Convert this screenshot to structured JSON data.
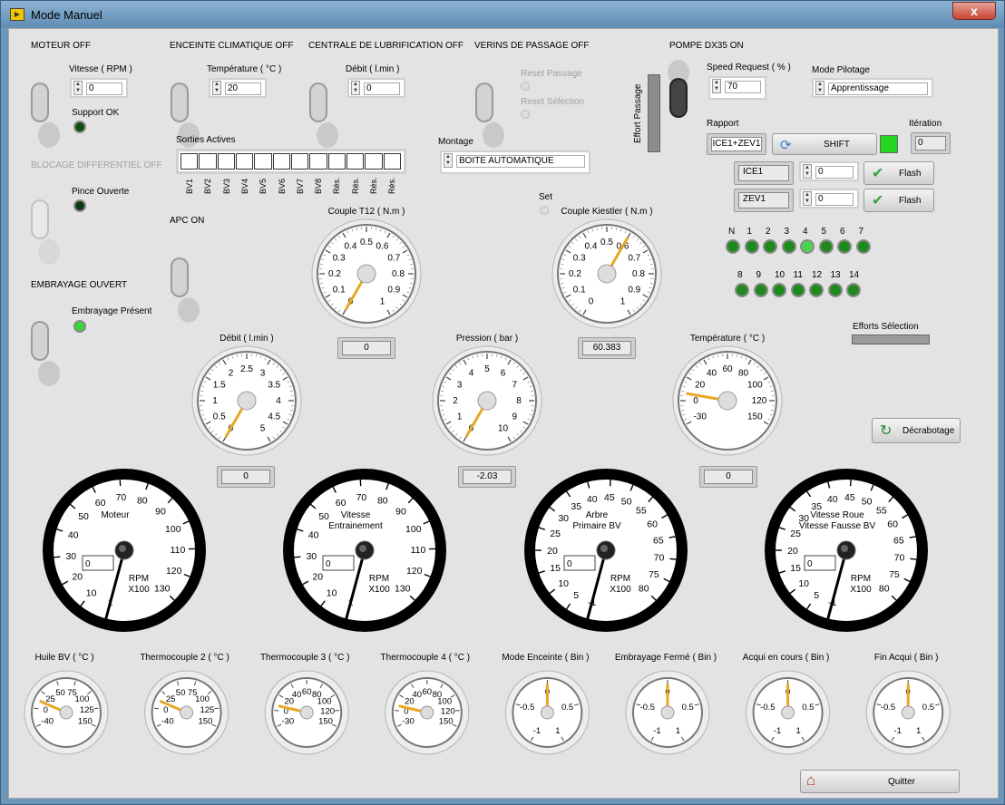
{
  "window": {
    "title": "Mode Manuel",
    "close": "x"
  },
  "moteur": {
    "title": "MOTEUR OFF",
    "vitesse_label": "Vitesse ( RPM )",
    "vitesse_value": "0",
    "support_label": "Support OK"
  },
  "enceinte": {
    "title": "ENCEINTE CLIMATIQUE OFF",
    "temp_label": "Température ( °C )",
    "temp_value": "20"
  },
  "lubrif": {
    "title": "CENTRALE DE LUBRIFICATION OFF",
    "debit_label": "Débit ( l.min )",
    "debit_value": "0"
  },
  "verins": {
    "title": "VERINS DE PASSAGE OFF",
    "reset_passage": "Reset Passage",
    "reset_selection": "Reset Sélection"
  },
  "pompe": {
    "title": "POMPE DX35 ON",
    "speed_label": "Speed Request  ( % )",
    "speed_value": "70",
    "effort_passage": "Effort Passage"
  },
  "pilotage": {
    "label": "Mode Pilotage",
    "value": "Apprentissage"
  },
  "rapport": {
    "label": "Rapport",
    "value": "ICE1+ZEV1",
    "shift": "SHIFT",
    "iteration_label": "Itération",
    "iteration_value": "0",
    "rows": [
      {
        "name": "ICE1",
        "value": "0",
        "flash": "Flash"
      },
      {
        "name": "ZEV1",
        "value": "0",
        "flash": "Flash"
      }
    ]
  },
  "blocage": {
    "title": "BLOCAGE DIFFERENTIEL OFF",
    "pince_label": "Pince Ouverte"
  },
  "apc": {
    "title": "APC ON"
  },
  "embrayage": {
    "title": "EMBRAYAGE OUVERT",
    "present_label": "Embrayage Présent"
  },
  "sorties": {
    "label": "Sorties Actives",
    "items": [
      "BV1",
      "BV2",
      "BV3",
      "BV4",
      "BV5",
      "BV6",
      "BV7",
      "BV8",
      "Rés.",
      "Rés.",
      "Rés.",
      "Rés."
    ]
  },
  "montage": {
    "label": "Montage",
    "value": "BOITE AUTOMATIQUE"
  },
  "set_label": "Set",
  "gears": {
    "row1": [
      "N",
      "1",
      "2",
      "3",
      "4",
      "5",
      "6",
      "7"
    ],
    "row2": [
      "8",
      "9",
      "10",
      "11",
      "12",
      "13",
      "14"
    ]
  },
  "efforts_selection": "Efforts Sélection",
  "decrabotage": "Décrabotage",
  "quitter": "Quitter",
  "colors": {
    "accent": "#e7a826",
    "led_on": "#35d835",
    "led_off": "#0f5a0f"
  },
  "gauges_mid": [
    {
      "id": "couple-t12",
      "title": "Couple T12 ( N.m )",
      "ticks": [
        "0",
        "0.1",
        "0.2",
        "0.3",
        "0.4",
        "0.5",
        "0.6",
        "0.7",
        "0.8",
        "0.9",
        "1"
      ],
      "min": 0,
      "max": 1,
      "value": 0,
      "readout": "0"
    },
    {
      "id": "couple-kiestler",
      "title": "Couple Kiestler ( N.m )",
      "ticks": [
        "0",
        "0.1",
        "0.2",
        "0.3",
        "0.4",
        "0.5",
        "0.6",
        "0.7",
        "0.8",
        "0.9",
        "1"
      ],
      "min": 0,
      "max": 1,
      "value": 0.6,
      "readout": "60.383"
    },
    {
      "id": "debit",
      "title": "Débit ( l.min )",
      "ticks": [
        "0",
        "0.5",
        "1",
        "1.5",
        "2",
        "2.5",
        "3",
        "3.5",
        "4",
        "4.5",
        "5"
      ],
      "min": 0,
      "max": 5,
      "value": 0,
      "readout": "0"
    },
    {
      "id": "pression",
      "title": "Pression ( bar )",
      "ticks": [
        "0",
        "1",
        "2",
        "3",
        "4",
        "5",
        "6",
        "7",
        "8",
        "9",
        "10"
      ],
      "min": 0,
      "max": 10,
      "value": 0,
      "readout": "-2.03"
    },
    {
      "id": "temperature",
      "title": "Température ( °C )",
      "ticks": [
        "-30",
        "0",
        "20",
        "40",
        "60",
        "80",
        "100",
        "120",
        "150"
      ],
      "min": -30,
      "max": 150,
      "value": 0,
      "readout": "0"
    }
  ],
  "gauges_big": [
    {
      "id": "moteur",
      "label1": "Moteur",
      "label2": "",
      "unit1": "RPM",
      "unit2": "X100",
      "ticks": [
        "1",
        "10",
        "20",
        "30",
        "40",
        "50",
        "60",
        "70",
        "80",
        "90",
        "100",
        "110",
        "120",
        "130"
      ],
      "value": "0"
    },
    {
      "id": "vitesse-entrainement",
      "label1": "Vitesse",
      "label2": "Entrainement",
      "unit1": "RPM",
      "unit2": "X100",
      "ticks": [
        "1",
        "10",
        "20",
        "30",
        "40",
        "50",
        "60",
        "70",
        "80",
        "90",
        "100",
        "110",
        "120",
        "130"
      ],
      "value": "0"
    },
    {
      "id": "arbre-primaire",
      "label1": "Arbre",
      "label2": "Primaire BV",
      "unit1": "RPM",
      "unit2": "X100",
      "ticks": [
        "-1",
        "5",
        "10",
        "15",
        "20",
        "25",
        "30",
        "35",
        "40",
        "45",
        "50",
        "55",
        "60",
        "65",
        "70",
        "75",
        "80"
      ],
      "value": "0"
    },
    {
      "id": "vitesse-roue",
      "label1": "Vitesse Roue",
      "label2": "Vitesse Fausse BV",
      "unit1": "RPM",
      "unit2": "X100",
      "ticks": [
        "-1",
        "5",
        "10",
        "15",
        "20",
        "25",
        "30",
        "35",
        "40",
        "45",
        "50",
        "55",
        "60",
        "65",
        "70",
        "75",
        "80"
      ],
      "value": "0"
    }
  ],
  "gauges_small": [
    {
      "id": "huile-bv",
      "title": "Huile BV ( °C )",
      "ticks": [
        "-40",
        "0",
        "25",
        "50",
        "75",
        "100",
        "125",
        "150"
      ],
      "min": -40,
      "max": 150,
      "value": 0
    },
    {
      "id": "thermo2",
      "title": "Thermocouple 2 ( °C )",
      "ticks": [
        "-40",
        "0",
        "25",
        "50",
        "75",
        "100",
        "125",
        "150"
      ],
      "min": -40,
      "max": 150,
      "value": 0
    },
    {
      "id": "thermo3",
      "title": "Thermocouple 3 ( °C )",
      "ticks": [
        "-30",
        "0",
        "20",
        "40",
        "60",
        "80",
        "100",
        "120",
        "150"
      ],
      "min": -30,
      "max": 150,
      "value": 0
    },
    {
      "id": "thermo4",
      "title": "Thermocouple 4 ( °C )",
      "ticks": [
        "-30",
        "0",
        "20",
        "40",
        "60",
        "80",
        "100",
        "120",
        "150"
      ],
      "min": -30,
      "max": 150,
      "value": 0
    },
    {
      "id": "mode-enceinte",
      "title": "Mode Enceinte ( Bin )",
      "ticks": [
        "-1",
        "-0.5",
        "0",
        "0.5",
        "1"
      ],
      "min": -1,
      "max": 1,
      "value": 0
    },
    {
      "id": "embrayage-ferme",
      "title": "Embrayage Fermé ( Bin )",
      "ticks": [
        "-1",
        "-0.5",
        "0",
        "0.5",
        "1"
      ],
      "min": -1,
      "max": 1,
      "value": 0
    },
    {
      "id": "acqui-en-cours",
      "title": "Acqui en cours ( Bin )",
      "ticks": [
        "-1",
        "-0.5",
        "0",
        "0.5",
        "1"
      ],
      "min": -1,
      "max": 1,
      "value": 0
    },
    {
      "id": "fin-acqui",
      "title": "Fin Acqui ( Bin )",
      "ticks": [
        "-1",
        "-0.5",
        "0",
        "0.5",
        "1"
      ],
      "min": -1,
      "max": 1,
      "value": 0
    }
  ]
}
